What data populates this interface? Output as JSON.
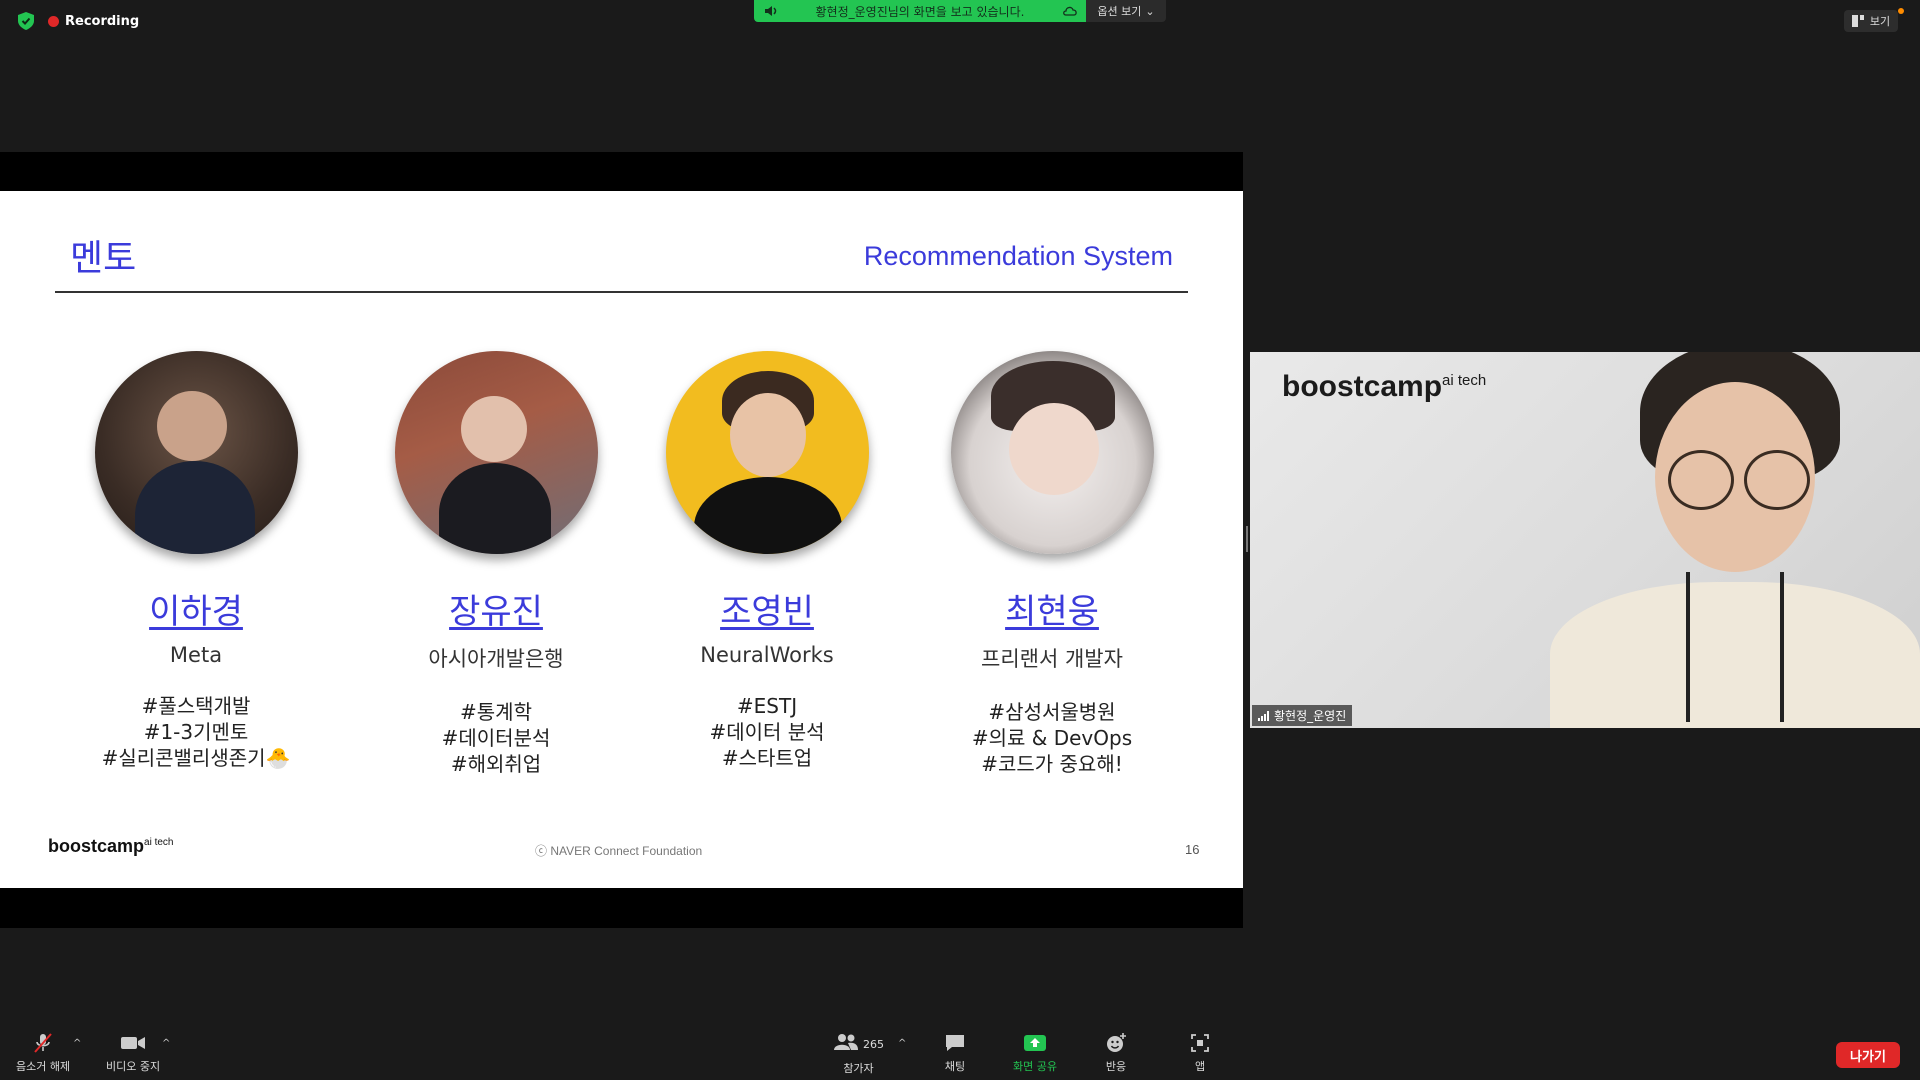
{
  "recording": {
    "label": "Recording"
  },
  "share_banner": {
    "text": "황현정_운영진님의 화면을 보고 있습니다.",
    "options_label": "옵션 보기"
  },
  "view_button": {
    "label": "보기"
  },
  "slide": {
    "title": "멘토",
    "topic": "Recommendation System",
    "mentors": [
      {
        "name": "이하경",
        "org": "Meta",
        "tags": [
          "#풀스택개발",
          "#1-3기멘토",
          "#실리콘밸리생존기🐣"
        ]
      },
      {
        "name": "장유진",
        "org": "아시아개발은행",
        "tags": [
          "#통계학",
          "#데이터분석",
          "#해외취업"
        ]
      },
      {
        "name": "조영빈",
        "org": "NeuralWorks",
        "tags": [
          "#ESTJ",
          "#데이터 분석",
          "#스타트업"
        ]
      },
      {
        "name": "최현웅",
        "org": "프리랜서 개발자",
        "tags": [
          "#삼성서울병원",
          "#의료 & DevOps",
          "#코드가 중요해!"
        ]
      }
    ],
    "footer_logo": "boostcamp",
    "footer_logo_sup": "ai tech",
    "copyright": "ⓒ  NAVER Connect Foundation",
    "page": "16"
  },
  "video": {
    "logo": "boostcamp",
    "logo_sup": "ai tech",
    "participant_name": "황현정_운영진"
  },
  "toolbar": {
    "unmute": "음소거 해제",
    "stop_video": "비디오 중지",
    "participants": "참가자",
    "participant_count": "265",
    "chat": "채팅",
    "share_screen": "화면 공유",
    "reactions": "반응",
    "apps": "앱",
    "leave": "나가기"
  },
  "colors": {
    "accent_green": "#23c552",
    "slide_blue": "#3b3bdb",
    "leave_red": "#e02828"
  }
}
